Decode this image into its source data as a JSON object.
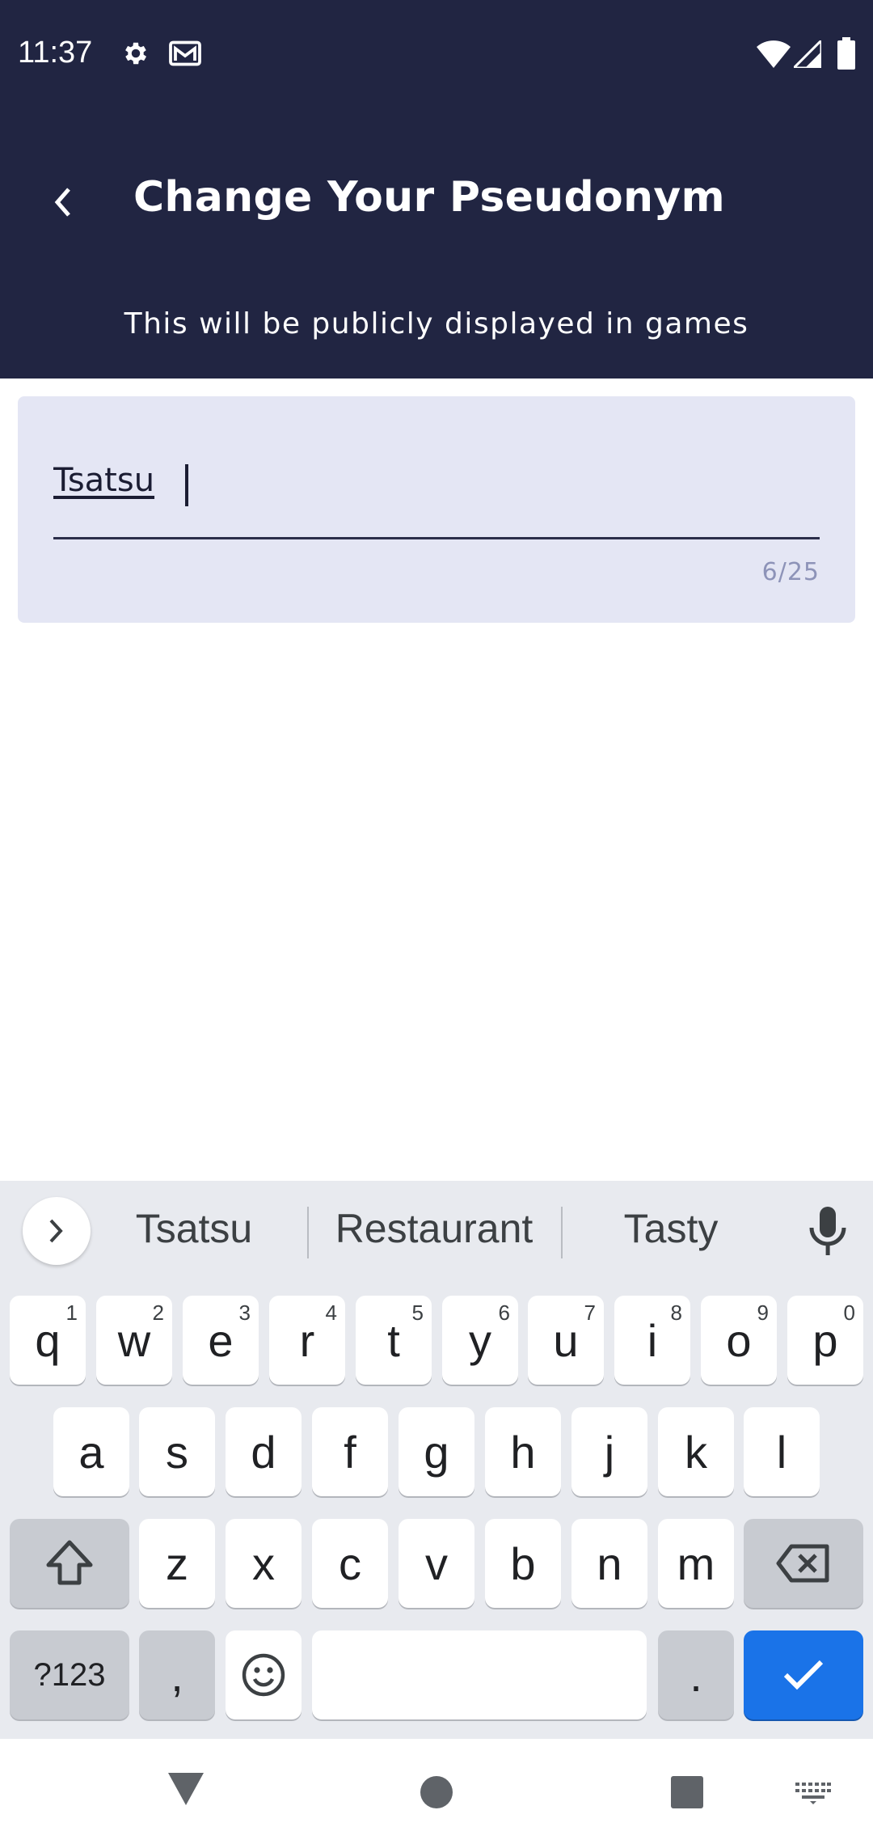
{
  "status_bar": {
    "time": "11:37",
    "left_icons": [
      "settings-icon",
      "mail-icon"
    ],
    "right_icons": [
      "wifi-icon",
      "signal-icon",
      "battery-icon"
    ]
  },
  "header": {
    "title": "Change Your Pseudonym",
    "subtitle": "This will be publicly displayed in games",
    "background_color": "#212542"
  },
  "pseudonym_field": {
    "value": "Tsatsu",
    "counter": "6/25"
  },
  "keyboard": {
    "suggestions": [
      "Tsatsu",
      "Restaurant",
      "Tasty"
    ],
    "row1": [
      {
        "label": "q",
        "hint": "1"
      },
      {
        "label": "w",
        "hint": "2"
      },
      {
        "label": "e",
        "hint": "3"
      },
      {
        "label": "r",
        "hint": "4"
      },
      {
        "label": "t",
        "hint": "5"
      },
      {
        "label": "y",
        "hint": "6"
      },
      {
        "label": "u",
        "hint": "7"
      },
      {
        "label": "i",
        "hint": "8"
      },
      {
        "label": "o",
        "hint": "9"
      },
      {
        "label": "p",
        "hint": "0"
      }
    ],
    "row2": [
      "a",
      "s",
      "d",
      "f",
      "g",
      "h",
      "j",
      "k",
      "l"
    ],
    "row3": [
      "z",
      "x",
      "c",
      "v",
      "b",
      "n",
      "m"
    ],
    "symbols_label": "?123",
    "comma_label": ",",
    "period_label": ".",
    "enter_color": "#1a73e8"
  },
  "nav_bar": {
    "icons": [
      "back-triangle-icon",
      "home-circle-icon",
      "recents-square-icon",
      "keyboard-icon"
    ]
  }
}
